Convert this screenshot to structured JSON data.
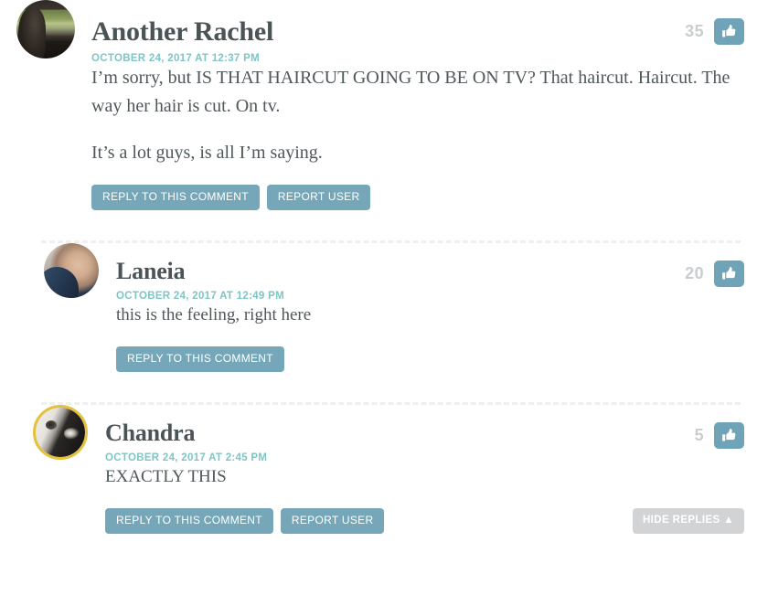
{
  "theme": {
    "accent_teal": "#76a7b9",
    "timestamp_teal": "#7ec5c6",
    "author_color": "#4a5356",
    "body_color": "#4f585b",
    "vote_count_color": "#c9cdcf",
    "hide_button_gray": "#d2d3d4",
    "avatar_ring_gold": "#e5c13c",
    "divider_color": "#efefef",
    "page_background": "#ffffff"
  },
  "comments": [
    {
      "author": "Another Rachel",
      "timestamp": "OCTOBER 24, 2017 AT 12:37 PM",
      "vote_count": "35",
      "avatar_name": "avatar-another-rachel",
      "avatar_has_gold_ring": false,
      "paragraphs": [
        "I’m sorry, but IS THAT HAIRCUT GOING TO BE ON TV? That haircut. Haircut. The way her hair is cut. On tv.",
        "It’s a lot guys, is all I’m saying."
      ],
      "actions": [
        {
          "label": "REPLY TO THIS COMMENT",
          "name": "reply-to-this-comment-button"
        },
        {
          "label": "REPORT USER",
          "name": "report-user-button"
        }
      ]
    },
    {
      "author": "Laneia",
      "timestamp": "OCTOBER 24, 2017 AT 12:49 PM",
      "vote_count": "20",
      "avatar_name": "avatar-laneia",
      "avatar_has_gold_ring": false,
      "paragraphs": [
        "this is the feeling, right here"
      ],
      "actions": [
        {
          "label": "REPLY TO THIS COMMENT",
          "name": "reply-to-this-comment-button"
        }
      ]
    },
    {
      "author": "Chandra",
      "timestamp": "OCTOBER 24, 2017 AT 2:45 PM",
      "vote_count": "5",
      "avatar_name": "avatar-chandra",
      "avatar_has_gold_ring": true,
      "paragraphs": [
        "EXACTLY THIS"
      ],
      "actions": [
        {
          "label": "REPLY TO THIS COMMENT",
          "name": "reply-to-this-comment-button"
        },
        {
          "label": "REPORT USER",
          "name": "report-user-button"
        }
      ],
      "hide_replies_label": "HIDE REPLIES ▲"
    }
  ],
  "icons": {
    "like": "thumbs-up-icon",
    "hide_replies_chevron": "triangle-up-icon"
  }
}
